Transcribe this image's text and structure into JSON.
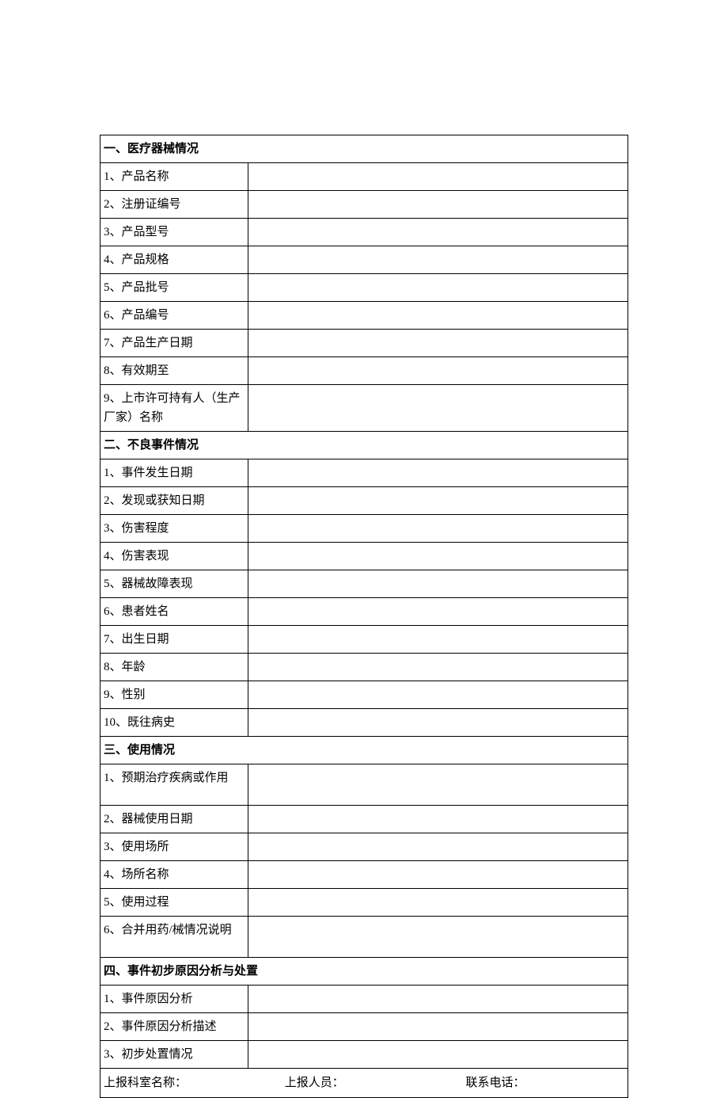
{
  "section1": {
    "header": "一、医疗器械情况",
    "items": [
      {
        "label": "1、产品名称",
        "value": ""
      },
      {
        "label": "2、注册证编号",
        "value": ""
      },
      {
        "label": "3、产品型号",
        "value": ""
      },
      {
        "label": "4、产品规格",
        "value": ""
      },
      {
        "label": "5、产品批号",
        "value": ""
      },
      {
        "label": "6、产品编号",
        "value": ""
      },
      {
        "label": "7、产品生产日期",
        "value": ""
      },
      {
        "label": "8、有效期至",
        "value": ""
      },
      {
        "label": "9、上市许可持有人（生产厂家）名称",
        "value": ""
      }
    ]
  },
  "section2": {
    "header": "二、不良事件情况",
    "items": [
      {
        "label": "1、事件发生日期",
        "value": ""
      },
      {
        "label": "2、发现或获知日期",
        "value": ""
      },
      {
        "label": "3、伤害程度",
        "value": ""
      },
      {
        "label": "4、伤害表现",
        "value": ""
      },
      {
        "label": "5、器械故障表现",
        "value": ""
      },
      {
        "label": "6、患者姓名",
        "value": ""
      },
      {
        "label": "7、出生日期",
        "value": ""
      },
      {
        "label": "8、年龄",
        "value": ""
      },
      {
        "label": "9、性别",
        "value": ""
      },
      {
        "label": "10、既往病史",
        "value": ""
      }
    ]
  },
  "section3": {
    "header": "三、使用情况",
    "items": [
      {
        "label": "1、预期治疗疾病或作用",
        "value": ""
      },
      {
        "label": "2、器械使用日期",
        "value": ""
      },
      {
        "label": "3、使用场所",
        "value": ""
      },
      {
        "label": "4、场所名称",
        "value": ""
      },
      {
        "label": "5、使用过程",
        "value": ""
      },
      {
        "label": "6、合并用药/械情况说明",
        "value": ""
      }
    ]
  },
  "section4": {
    "header": "四、事件初步原因分析与处置",
    "items": [
      {
        "label": "1、事件原因分析",
        "value": ""
      },
      {
        "label": "2、事件原因分析描述",
        "value": ""
      },
      {
        "label": "3、初步处置情况",
        "value": ""
      }
    ]
  },
  "footer": {
    "dept_label": "上报科室名称：",
    "dept_value": "",
    "person_label": "上报人员：",
    "person_value": "",
    "phone_label": "联系电话：",
    "phone_value": ""
  }
}
